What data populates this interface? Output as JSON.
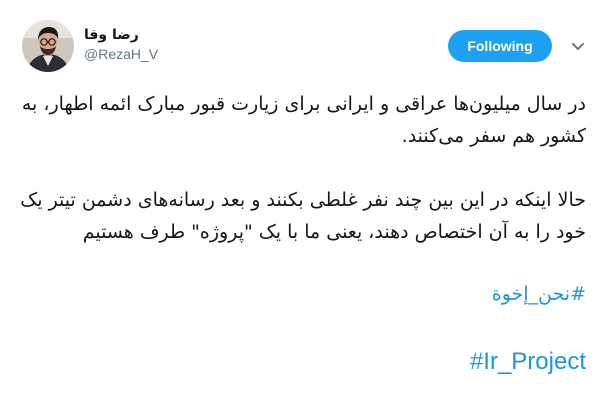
{
  "user": {
    "display_name": "رضا وفا",
    "handle": "@RezaH_V",
    "avatar_icon": "profile-photo"
  },
  "follow_button": {
    "label": "Following",
    "color": "#1da1f2"
  },
  "menu_icon": "chevron-down-icon",
  "tweet": {
    "paragraph_1": "در سال میلیون‌ها عراقی و ایرانی برای زیارت قبور مبارک ائمه اطهار، به کشور هم سفر می‌کنند.",
    "paragraph_2": "حالا اینکه در این بین چند نفر غلطی بکنند و بعد رسانه‌های دشمن تیتر یک خود را به آن اختصاص دهند، یعنی ما با یک \"پروژه\" طرف هستیم",
    "hashtag_1": "#نحن_إخوة",
    "hashtag_2": "#Ir_Project",
    "link_color": "#1b95e0"
  }
}
